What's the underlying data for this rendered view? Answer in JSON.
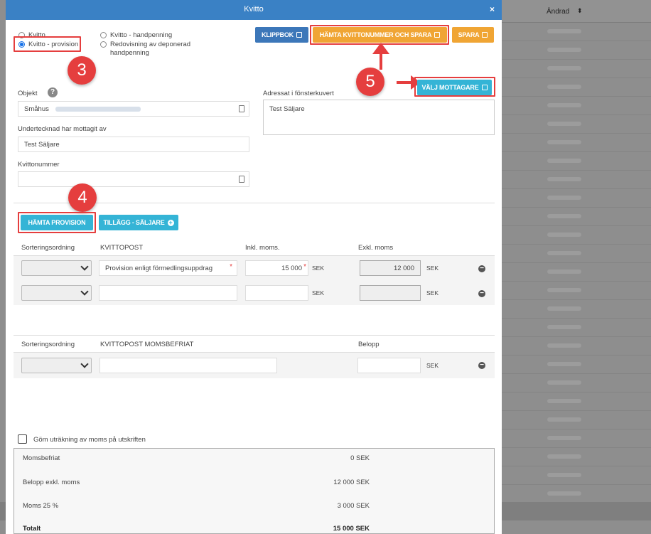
{
  "background": {
    "column_header": "Ändrad",
    "sort_icon": "sort-icon"
  },
  "modal": {
    "title": "Kvitto",
    "close_label": "×"
  },
  "receipt_type": {
    "options": [
      {
        "label": "Kvitto",
        "checked": false
      },
      {
        "label": "Kvitto - provision",
        "checked": true
      },
      {
        "label": "Kvitto - handpenning",
        "checked": false
      },
      {
        "label": "Redovisning av deponerad handpenning",
        "checked": false
      }
    ]
  },
  "toolbar": {
    "clipbook_label": "KLIPPBOK",
    "fetch_number_save_label": "HÄMTA KVITTONUMMER OCH SPARA",
    "save_label": "SPARA",
    "select_recipient_label": "VÄLJ MOTTAGARE"
  },
  "callouts": {
    "step3": "3",
    "step4": "4",
    "step5": "5"
  },
  "form": {
    "object_label": "Objekt",
    "object_help": "?",
    "object_value": "Småhus",
    "signed_by_label": "Undertecknad har mottagit av",
    "signed_by_value": "Test Säljare",
    "receipt_number_label": "Kvittonummer",
    "receipt_number_value": "",
    "window_address_label": "Adressat i fönsterkuvert",
    "window_address_value": "Test Säljare"
  },
  "actions": {
    "fetch_commission_label": "HÄMTA PROVISION",
    "add_seller_label": "TILLÄGG - SÄLJARE",
    "add_icon": "+"
  },
  "items_table": {
    "headers": [
      "Sorteringsordning",
      "KVITTOPOST",
      "Inkl. moms.",
      "Exkl. moms"
    ],
    "rows": [
      {
        "item": "Provision enligt förmedlingsuppdrag",
        "incl_vat": "15 000",
        "incl_currency": "SEK",
        "excl_vat": "12 000",
        "excl_currency": "SEK",
        "remove": "−"
      },
      {
        "item": "",
        "incl_vat": "",
        "incl_currency": "SEK",
        "excl_vat": "",
        "excl_currency": "SEK",
        "remove": "−"
      }
    ]
  },
  "exempt_table": {
    "headers": [
      "Sorteringsordning",
      "KVITTOPOST MOMSBEFRIAT",
      "Belopp"
    ],
    "rows": [
      {
        "item": "",
        "amount": "",
        "currency": "SEK",
        "remove": "−"
      }
    ]
  },
  "hide_vat": {
    "label": "Göm uträkning av moms på utskriften",
    "checked": false
  },
  "summary": {
    "rows": [
      {
        "label": "Momsbefriat",
        "value": "0 SEK"
      },
      {
        "label": "Belopp exkl. moms",
        "value": "12 000 SEK"
      },
      {
        "label": "Moms 25 %",
        "value": "3 000 SEK"
      },
      {
        "label": "Totalt",
        "value": "15 000 SEK"
      }
    ]
  }
}
